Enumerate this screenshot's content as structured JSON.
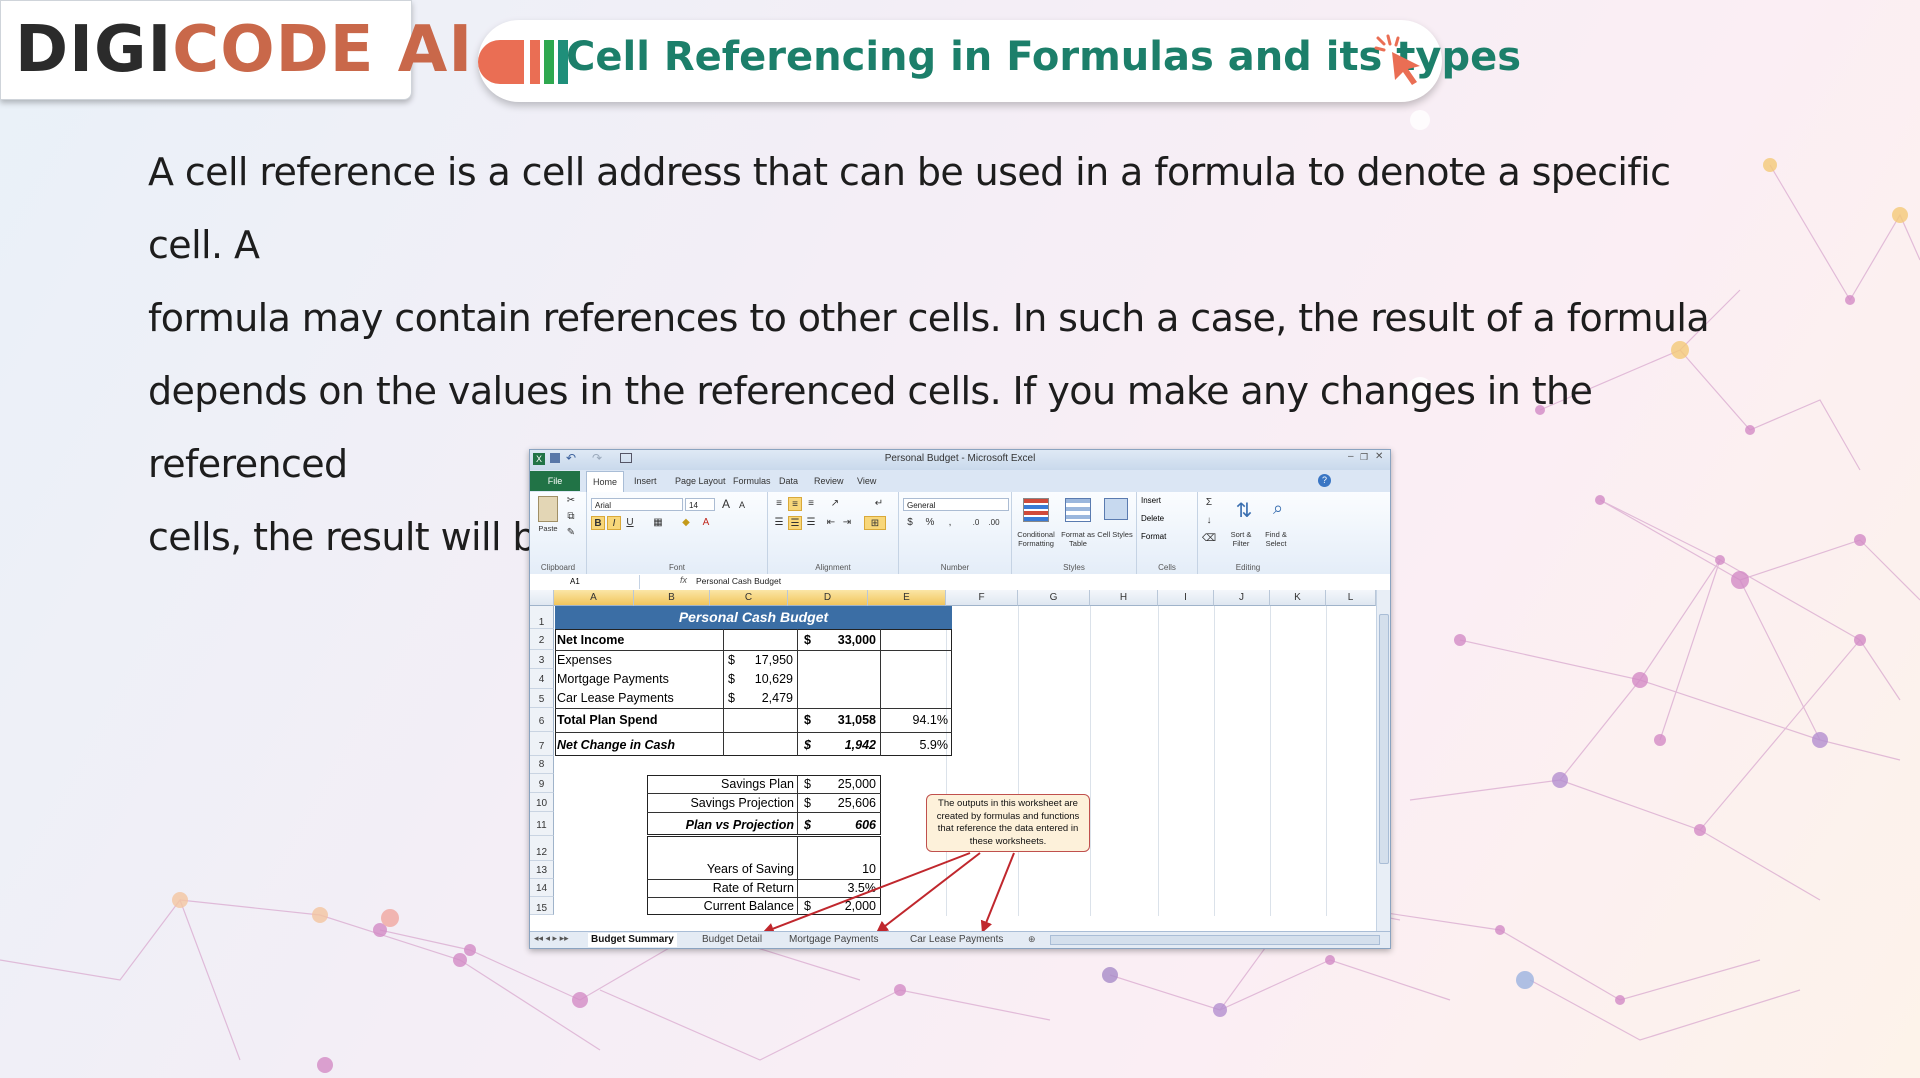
{
  "brand": {
    "logo_dark": "DIGI",
    "logo_accent": "CODE AI"
  },
  "header": {
    "title": "Cell Referencing in Formulas and its types"
  },
  "intro": {
    "lines": [
      "A cell reference is a cell address that can be used in a formula to denote a specific cell. A",
      "formula may contain references to other cells. In such a case, the result of a formula",
      "depends on the values in the referenced cells. If you make any changes in the referenced",
      "cells, the result will be changed automatically."
    ]
  },
  "excel": {
    "window_title": "Personal Budget - Microsoft Excel",
    "tabs": {
      "file": "File",
      "items": [
        "Home",
        "Insert",
        "Page Layout",
        "Formulas",
        "Data",
        "Review",
        "View"
      ]
    },
    "ribbon": {
      "clipboard": {
        "label": "Clipboard",
        "paste": "Paste"
      },
      "font": {
        "label": "Font",
        "name": "Arial",
        "size": "14",
        "bold": "B",
        "italic": "I",
        "underline": "U"
      },
      "alignment": {
        "label": "Alignment"
      },
      "number": {
        "label": "Number",
        "format": "General",
        "currency": "$",
        "percent": "%",
        "comma": ","
      },
      "styles": {
        "label": "Styles",
        "conditional": "Conditional Formatting",
        "format_table": "Format as Table",
        "cell_styles": "Cell Styles"
      },
      "cells": {
        "label": "Cells",
        "insert": "Insert",
        "delete": "Delete",
        "format": "Format"
      },
      "editing": {
        "label": "Editing",
        "sort": "Sort & Filter",
        "find": "Find & Select"
      }
    },
    "name_box": "A1",
    "fx": "fx",
    "formula": "Personal Cash Budget",
    "columns": [
      "A",
      "B",
      "C",
      "D",
      "E",
      "F",
      "G",
      "H",
      "I",
      "J",
      "K",
      "L"
    ],
    "rows": [
      "1",
      "2",
      "3",
      "4",
      "5",
      "6",
      "7",
      "8",
      "9",
      "10",
      "11",
      "12",
      "13",
      "14",
      "15"
    ],
    "sheet": {
      "banner": "Personal Cash Budget",
      "net_income": {
        "label": "Net Income",
        "cur": "$",
        "value": "33,000"
      },
      "expenses": {
        "label": "Expenses",
        "cur": "$",
        "value": "17,950"
      },
      "mortgage": {
        "label": "Mortgage Payments",
        "cur": "$",
        "value": "10,629"
      },
      "car_lease": {
        "label": "Car Lease Payments",
        "cur": "$",
        "value": "2,479"
      },
      "total_spend": {
        "label": "Total Plan Spend",
        "cur": "$",
        "value": "31,058",
        "pct": "94.1%"
      },
      "net_change": {
        "label": "Net Change in Cash",
        "cur": "$",
        "value": "1,942",
        "pct": "5.9%"
      },
      "savings_plan": {
        "label": "Savings Plan",
        "cur": "$",
        "value": "25,000"
      },
      "savings_projection": {
        "label": "Savings Projection",
        "cur": "$",
        "value": "25,606"
      },
      "plan_vs_projection": {
        "label": "Plan vs Projection",
        "cur": "$",
        "value": "606"
      },
      "years_saving": {
        "label": "Years of Saving",
        "value": "10"
      },
      "rate_return": {
        "label": "Rate of Return",
        "value": "3.5%"
      },
      "current_balance": {
        "label": "Current Balance",
        "cur": "$",
        "value": "2,000"
      }
    },
    "callout": "The outputs in this worksheet are created by formulas and functions that reference the data entered in these worksheets.",
    "sheet_tabs": [
      "Budget Summary",
      "Budget Detail",
      "Mortgage Payments",
      "Car Lease Payments"
    ]
  }
}
